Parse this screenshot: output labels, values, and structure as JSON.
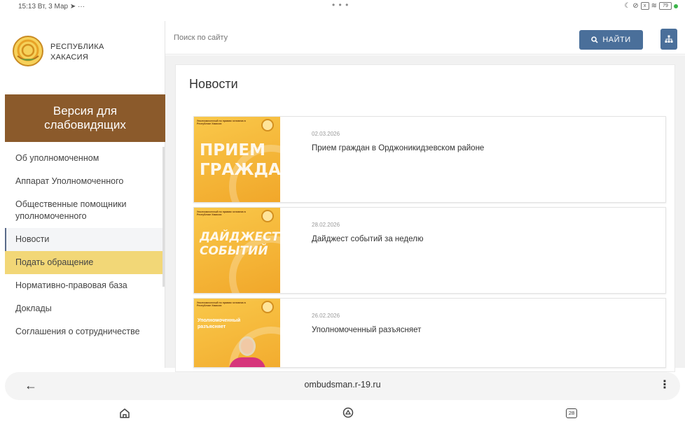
{
  "status_bar": {
    "time_date": "15:13 Вт, 3 Мар",
    "dots": "• • •",
    "battery": "79"
  },
  "sidebar": {
    "logo_line1": "РЕСПУБЛИКА",
    "logo_line2": "ХАКАСИЯ",
    "vision_button_line1": "Версия для",
    "vision_button_line2": "слабовидящих",
    "items": [
      {
        "label": "Об уполномоченном"
      },
      {
        "label": "Аппарат Уполномоченного"
      },
      {
        "label": "Общественные помощники уполномоченного"
      },
      {
        "label": "Новости"
      },
      {
        "label": "Подать обращение"
      },
      {
        "label": "Нормативно-правовая база"
      },
      {
        "label": "Доклады"
      },
      {
        "label": "Соглашения о сотрудничестве"
      }
    ]
  },
  "header": {
    "search_placeholder": "Поиск по сайту",
    "search_button": "НАЙТИ"
  },
  "main": {
    "title": "Новости",
    "news": [
      {
        "date": "02.03.2026",
        "title": "Прием граждан в Орджоникидзевском районе",
        "thumb_small": "Уполномоченный по правам человека в Республике Хакасия",
        "thumb_text_1": "ПРИЕМ",
        "thumb_text_2": "ГРАЖДАН"
      },
      {
        "date": "28.02.2026",
        "title": "Дайджест событий за неделю",
        "thumb_small": "Уполномоченный по правам человека в Республике Хакасия",
        "thumb_text_1": "ДАЙДЖЕСТ",
        "thumb_text_2": "СОБЫТИЙ"
      },
      {
        "date": "26.02.2026",
        "title": "Уполномоченный разъясняет",
        "thumb_small": "Уполномоченный по правам человека в Республике Хакасия",
        "thumb_text_1": "Уполномоченный",
        "thumb_text_2": "разъясняет"
      }
    ]
  },
  "browser": {
    "url": "ombudsman.r-19.ru",
    "tabs_count": "28"
  },
  "colors": {
    "vision_bg": "#8b5a2b",
    "highlight": "#f2d777",
    "accent_button": "#4a6f9a"
  }
}
